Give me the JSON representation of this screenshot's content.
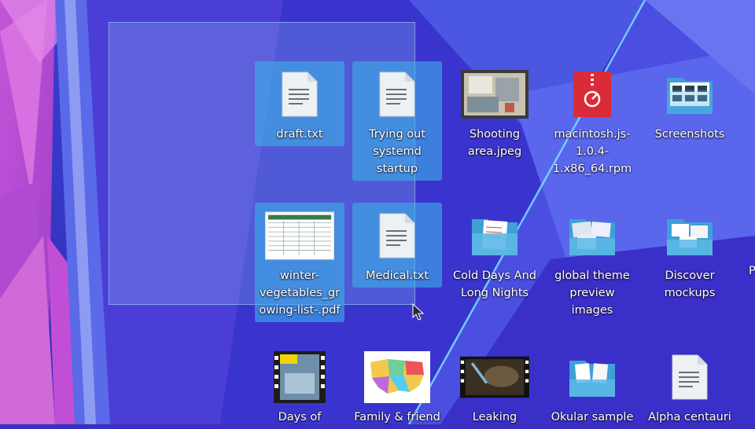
{
  "desktop": {
    "icons": [
      {
        "label": "draft.txt",
        "type": "text-file-icon",
        "selected": true
      },
      {
        "label": "Trying out systemd startup",
        "type": "text-file-icon",
        "selected": true
      },
      {
        "label": "Shooting area.jpeg",
        "type": "photo-thumbnail",
        "selected": false
      },
      {
        "label": "macintosh.js-1.0.4-1.x86_64.rpm",
        "type": "rpm-package-icon",
        "selected": false
      },
      {
        "label": "Screenshots",
        "type": "folder-icon",
        "selected": false
      },
      {
        "label": "winter-vegetables_growing-list-.pdf",
        "type": "pdf-thumbnail",
        "selected": true
      },
      {
        "label": "Medical.txt",
        "type": "text-file-icon",
        "selected": true
      },
      {
        "label": "Cold Days And Long Nights",
        "type": "folder-icon",
        "selected": false
      },
      {
        "label": "global theme preview images",
        "type": "folder-icon",
        "selected": false
      },
      {
        "label": "Discover mockups",
        "type": "folder-icon",
        "selected": false
      },
      {
        "label": "Days of",
        "type": "video-thumbnail",
        "selected": false
      },
      {
        "label": "Family & friend",
        "type": "map-thumbnail",
        "selected": false
      },
      {
        "label": "Leaking",
        "type": "video-thumbnail",
        "selected": false
      },
      {
        "label": "Okular sample",
        "type": "folder-icon",
        "selected": false
      },
      {
        "label": "Alpha centauri",
        "type": "text-file-icon",
        "selected": false
      }
    ],
    "edge_label": "P"
  },
  "colors": {
    "selection": "#3daee9",
    "folder": "#5cb8e6",
    "rpm": "#da2c38",
    "wallpaper_blue": "#3a2fbf",
    "wallpaper_magenta": "#c44fd6"
  }
}
